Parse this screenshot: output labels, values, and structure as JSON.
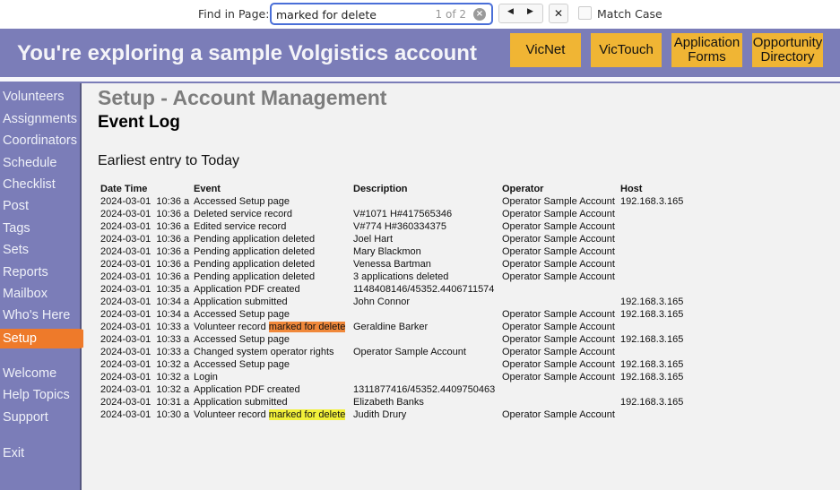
{
  "findbar": {
    "label": "Find in Page:",
    "query": "marked for delete",
    "match_count": "1 of 2",
    "clear_icon": "×",
    "prev_icon": "◀",
    "next_icon": "▶",
    "close_icon": "✕",
    "match_case_label": "Match Case",
    "match_case_checked": false,
    "highlight_current_color": "#f0883a",
    "highlight_other_color": "#f2f03a"
  },
  "header": {
    "title": "You're exploring a sample Volgistics account",
    "buttons": [
      {
        "label": "VicNet"
      },
      {
        "label": "VicTouch"
      },
      {
        "label": "Application Forms"
      },
      {
        "label": "Opportunity Directory"
      }
    ],
    "band_color": "#7b7db8",
    "button_color": "#f0b534"
  },
  "sidebar": {
    "items": [
      {
        "label": "Volunteers"
      },
      {
        "label": "Assignments"
      },
      {
        "label": "Coordinators"
      },
      {
        "label": "Schedule"
      },
      {
        "label": "Checklist"
      },
      {
        "label": "Post"
      },
      {
        "label": "Tags"
      },
      {
        "label": "Sets"
      },
      {
        "label": "Reports"
      },
      {
        "label": "Mailbox"
      },
      {
        "label": "Who's Here"
      },
      {
        "label": "Setup",
        "active": true
      }
    ],
    "secondary_items": [
      {
        "label": "Welcome"
      },
      {
        "label": "Help Topics"
      },
      {
        "label": "Support"
      }
    ],
    "exit_label": "Exit",
    "active_color": "#ee7a2a"
  },
  "main": {
    "page_title": "Setup - Account Management",
    "section_title": "Event Log",
    "range_text": "Earliest entry to Today",
    "table": {
      "headers": [
        "Date Time",
        "Event",
        "Description",
        "Operator",
        "Host"
      ],
      "rows": [
        {
          "date": "2024-03-01",
          "time": "10:36 a",
          "event": "Accessed Setup page",
          "description": "",
          "operator": "Operator Sample Account",
          "host": "192.168.3.165"
        },
        {
          "date": "2024-03-01",
          "time": "10:36 a",
          "event": "Deleted service record",
          "description": "V#1071 H#417565346",
          "operator": "Operator Sample Account",
          "host": ""
        },
        {
          "date": "2024-03-01",
          "time": "10:36 a",
          "event": "Edited service record",
          "description": "V#774 H#360334375",
          "operator": "Operator Sample Account",
          "host": ""
        },
        {
          "date": "2024-03-01",
          "time": "10:36 a",
          "event": "Pending application deleted",
          "description": "Joel Hart",
          "operator": "Operator Sample Account",
          "host": ""
        },
        {
          "date": "2024-03-01",
          "time": "10:36 a",
          "event": "Pending application deleted",
          "description": "Mary Blackmon",
          "operator": "Operator Sample Account",
          "host": ""
        },
        {
          "date": "2024-03-01",
          "time": "10:36 a",
          "event": "Pending application deleted",
          "description": "Venessa Bartman",
          "operator": "Operator Sample Account",
          "host": ""
        },
        {
          "date": "2024-03-01",
          "time": "10:36 a",
          "event": "Pending application deleted",
          "description": "3 applications deleted",
          "operator": "Operator Sample Account",
          "host": ""
        },
        {
          "date": "2024-03-01",
          "time": "10:35 a",
          "event": "Application PDF created",
          "description": "1148408146/45352.4406711574",
          "operator": "",
          "host": ""
        },
        {
          "date": "2024-03-01",
          "time": "10:34 a",
          "event": "Application submitted",
          "description": "John Connor",
          "operator": "",
          "host": "192.168.3.165"
        },
        {
          "date": "2024-03-01",
          "time": "10:34 a",
          "event": "Accessed Setup page",
          "description": "",
          "operator": "Operator Sample Account",
          "host": "192.168.3.165"
        },
        {
          "date": "2024-03-01",
          "time": "10:33 a",
          "event": "Volunteer record ",
          "event_highlight": "marked for delete",
          "highlight": "current",
          "description": "Geraldine Barker",
          "operator": "Operator Sample Account",
          "host": ""
        },
        {
          "date": "2024-03-01",
          "time": "10:33 a",
          "event": "Accessed Setup page",
          "description": "",
          "operator": "Operator Sample Account",
          "host": "192.168.3.165"
        },
        {
          "date": "2024-03-01",
          "time": "10:33 a",
          "event": "Changed system operator rights",
          "description": "Operator Sample Account",
          "operator": "Operator Sample Account",
          "host": ""
        },
        {
          "date": "2024-03-01",
          "time": "10:32 a",
          "event": "Accessed Setup page",
          "description": "",
          "operator": "Operator Sample Account",
          "host": "192.168.3.165"
        },
        {
          "date": "2024-03-01",
          "time": "10:32 a",
          "event": "Login",
          "description": "",
          "operator": "Operator Sample Account",
          "host": "192.168.3.165"
        },
        {
          "date": "2024-03-01",
          "time": "10:32 a",
          "event": "Application PDF created",
          "description": "1311877416/45352.4409750463",
          "operator": "",
          "host": ""
        },
        {
          "date": "2024-03-01",
          "time": "10:31 a",
          "event": "Application submitted",
          "description": "Elizabeth Banks",
          "operator": "",
          "host": "192.168.3.165"
        },
        {
          "date": "2024-03-01",
          "time": "10:30 a",
          "event": "Volunteer record ",
          "event_highlight": "marked for delete",
          "highlight": "other",
          "description": "Judith Drury",
          "operator": "Operator Sample Account",
          "host": ""
        }
      ]
    }
  }
}
